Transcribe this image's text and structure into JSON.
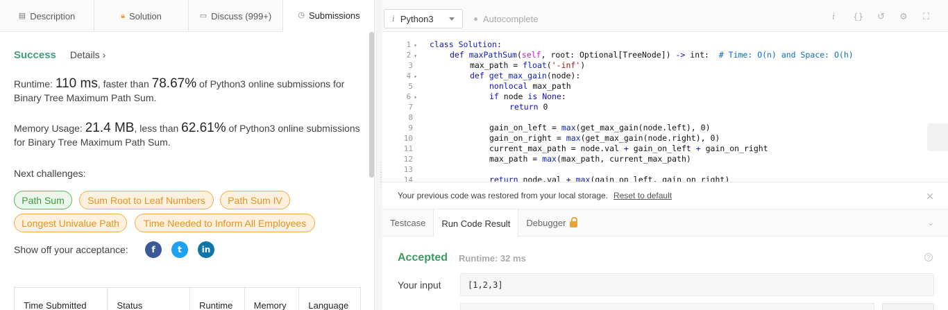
{
  "left_tabs": [
    {
      "label": "Description",
      "icon": "description-icon"
    },
    {
      "label": "Solution",
      "icon": "lock-icon"
    },
    {
      "label": "Discuss (999+)",
      "icon": "discuss-icon"
    },
    {
      "label": "Submissions",
      "icon": "clock-icon"
    }
  ],
  "result": {
    "status": "Success",
    "details": "Details ›"
  },
  "runtime": {
    "prefix": "Runtime: ",
    "value": "110 ms",
    "mid": ", faster than ",
    "percent": "78.67%",
    "suffix": " of Python3 online submissions for Binary Tree Maximum Path Sum."
  },
  "memory": {
    "prefix": "Memory Usage: ",
    "value": "21.4 MB",
    "mid": ", less than ",
    "percent": "62.61%",
    "suffix": " of Python3 online submissions for Binary Tree Maximum Path Sum."
  },
  "next_challenges": {
    "label": "Next challenges:",
    "items": [
      {
        "label": "Path Sum",
        "difficulty": "easy",
        "color": "#5cb85c"
      },
      {
        "label": "Sum Root to Leaf Numbers",
        "difficulty": "medium",
        "color": "#f0ad4e"
      },
      {
        "label": "Path Sum IV",
        "difficulty": "medium",
        "color": "#f0ad4e"
      },
      {
        "label": "Longest Univalue Path",
        "difficulty": "medium",
        "color": "#f0ad4e"
      },
      {
        "label": "Time Needed to Inform All Employees",
        "difficulty": "medium",
        "color": "#f0ad4e"
      }
    ]
  },
  "share": {
    "label": "Show off your acceptance:",
    "icons": [
      {
        "name": "facebook-icon",
        "glyph": "f"
      },
      {
        "name": "twitter-icon",
        "glyph": "t"
      },
      {
        "name": "linkedin-icon",
        "glyph": "in"
      }
    ]
  },
  "table": {
    "headers": [
      "Time Submitted",
      "Status",
      "Runtime",
      "Memory",
      "Language"
    ]
  },
  "editor_toolbar": {
    "language": "Python3",
    "autocomplete": "Autocomplete",
    "tools": [
      {
        "name": "info-icon",
        "glyph": "i"
      },
      {
        "name": "braces-icon",
        "glyph": "{}"
      },
      {
        "name": "reset-icon",
        "glyph": "↺"
      },
      {
        "name": "settings-icon",
        "glyph": "⚙"
      },
      {
        "name": "fullscreen-icon",
        "glyph": "⛶"
      }
    ]
  },
  "code_lines": [
    {
      "n": "1",
      "fold": true
    },
    {
      "n": "2",
      "fold": true
    },
    {
      "n": "3",
      "fold": false
    },
    {
      "n": "4",
      "fold": true
    },
    {
      "n": "5",
      "fold": false
    },
    {
      "n": "6",
      "fold": true
    },
    {
      "n": "7",
      "fold": false
    },
    {
      "n": "8",
      "fold": false
    },
    {
      "n": "9",
      "fold": false
    },
    {
      "n": "10",
      "fold": false
    },
    {
      "n": "11",
      "fold": false
    },
    {
      "n": "12",
      "fold": false
    },
    {
      "n": "13",
      "fold": false
    },
    {
      "n": "14",
      "fold": false
    }
  ],
  "code": {
    "l1": [
      "class",
      " ",
      "Solution",
      ":"
    ],
    "l2": [
      "def",
      " ",
      "maxPathSum",
      "(",
      "self",
      ", root: Optional[TreeNode]) ",
      "->",
      " int:  ",
      "# Time: O(n) and Space: O(h)"
    ],
    "l3": [
      "max_path = ",
      "float",
      "(",
      "'-inf'",
      ")"
    ],
    "l4": [
      "def",
      " ",
      "get_max_gain",
      "(node):"
    ],
    "l5": [
      "nonlocal",
      " max_path"
    ],
    "l6": [
      "if",
      " node ",
      "is",
      " ",
      "None",
      ":"
    ],
    "l7": [
      "return",
      " 0"
    ],
    "l9": [
      "gain_on_left = ",
      "max",
      "(get_max_gain(node.left), 0)"
    ],
    "l10": [
      "gain_on_right = ",
      "max",
      "(get_max_gain(node.right), 0)"
    ],
    "l11": [
      "current_max_path = node.val ",
      "+",
      " gain_on_left ",
      "+",
      " gain_on_right"
    ],
    "l12": [
      "max_path = ",
      "max",
      "(max_path, current_max_path)"
    ],
    "l14": [
      "return",
      " node.val ",
      "+",
      " ",
      "max",
      "(gain_on_left, gain_on_right)"
    ]
  },
  "banner": {
    "text": "Your previous code was restored from your local storage.",
    "reset": "Reset to default"
  },
  "console_tabs": [
    "Testcase",
    "Run Code Result",
    "Debugger"
  ],
  "console": {
    "status": "Accepted",
    "runtime": "Runtime: 32 ms",
    "your_input_label": "Your input",
    "your_input_value": "[1,2,3]"
  }
}
